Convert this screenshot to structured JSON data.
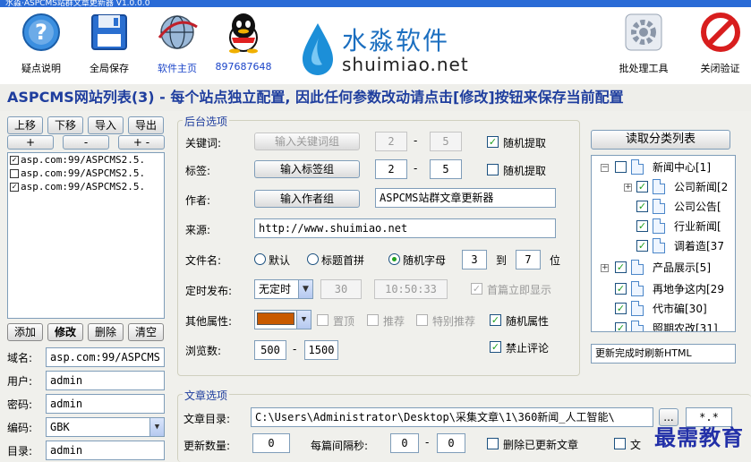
{
  "window": {
    "title": "水淼·ASPCMS站群文章更新器 V1.0.0.0"
  },
  "toolbar": {
    "items": [
      {
        "label": "疑点说明",
        "icon": "help-icon"
      },
      {
        "label": "全局保存",
        "icon": "save-icon"
      },
      {
        "label": "软件主页",
        "icon": "globe-icon"
      },
      {
        "label": "897687648",
        "icon": "qq-icon"
      }
    ],
    "brand_cn": "水淼软件",
    "brand_en": "shuimiao.net",
    "batch_label": "批处理工具",
    "close_label": "关闭验证"
  },
  "banner": "ASPCMS网站列表(3) - 每个站点独立配置, 因此任何参数改动请点击[修改]按钮来保存当前配置",
  "sitelist": {
    "buttons": {
      "up": "上移",
      "down": "下移",
      "import": "导入",
      "export": "导出",
      "plus": "+",
      "minus": "-",
      "plusminus": "+ -"
    },
    "items": [
      {
        "text": "asp.com:99/ASPCMS2.5.",
        "checked": true
      },
      {
        "text": "asp.com:99/ASPCMS2.5.",
        "checked": false
      },
      {
        "text": "asp.com:99/ASPCMS2.5.",
        "checked": true
      }
    ],
    "actions": {
      "add": "添加",
      "modify": "修改",
      "delete": "删除",
      "clear": "清空"
    }
  },
  "site_form": {
    "domain_label": "域名:",
    "domain": "asp.com:99/ASPCMS",
    "user_label": "用户:",
    "user": "admin",
    "pass_label": "密码:",
    "pass": "admin",
    "enc_label": "编码:",
    "enc": "GBK",
    "dir_label": "目录:",
    "dir": "admin"
  },
  "backend": {
    "title": "后台选项",
    "keyword_label": "关键词:",
    "keyword_btn": "输入关键词组",
    "keyword_min": "2",
    "keyword_max": "5",
    "keyword_random": "随机提取",
    "tag_label": "标签:",
    "tag_btn": "输入标签组",
    "tag_min": "2",
    "tag_max": "5",
    "tag_random": "随机提取",
    "author_label": "作者:",
    "author_btn": "输入作者组",
    "author_value": "ASPCMS站群文章更新器",
    "source_label": "来源:",
    "source_value": "http://www.shuimiao.net",
    "filename_label": "文件名:",
    "fn_default": "默认",
    "fn_pinyin": "标题首拼",
    "fn_random": "随机字母",
    "fn_from": "3",
    "fn_to_label": "到",
    "fn_to": "7",
    "fn_unit": "位",
    "sched_label": "定时发布:",
    "sched_mode": "无定时",
    "sched_num": "30",
    "sched_time": "10:50:33",
    "sched_first": "首篇立即显示",
    "other_label": "其他属性:",
    "attr_top": "置顶",
    "attr_recommend": "推荐",
    "attr_special": "特别推荐",
    "attr_random": "随机属性",
    "views_label": "浏览数:",
    "views_min": "500",
    "views_max": "1500",
    "no_comment": "禁止评论",
    "dash": "-"
  },
  "category": {
    "read_btn": "读取分类列表",
    "tree": [
      {
        "label": "新闻中心[1]",
        "level": 0
      },
      {
        "label": "公司新闻[2",
        "level": 1
      },
      {
        "label": "公司公告[",
        "level": 2
      },
      {
        "label": "行业新闻[",
        "level": 2
      },
      {
        "label": "调着造[37",
        "level": 2
      },
      {
        "label": "产品展示[5]",
        "level": 0
      },
      {
        "label": "再地争这内[29",
        "level": 1
      },
      {
        "label": "代市碥[30]",
        "level": 1
      },
      {
        "label": "照期农改[31]",
        "level": 1
      }
    ],
    "refresh_option": "更新完成时刷新HTML"
  },
  "article": {
    "title": "文章选项",
    "dir_label": "文章目录:",
    "dir_value": "C:\\Users\\Administrator\\Desktop\\采集文章\\1\\360新闻_人工智能\\",
    "browse": "...",
    "ext": "*.*",
    "count_label": "更新数量:",
    "count": "0",
    "interval_label": "每篇间隔秒:",
    "interval_min": "0",
    "interval_max": "0",
    "delete_updated": "删除已更新文章",
    "other": "文"
  },
  "watermark": "最需教育",
  "colors": {
    "accent": "#1f3e9e",
    "check": "#21a121",
    "attr_color": "#c85a00"
  }
}
